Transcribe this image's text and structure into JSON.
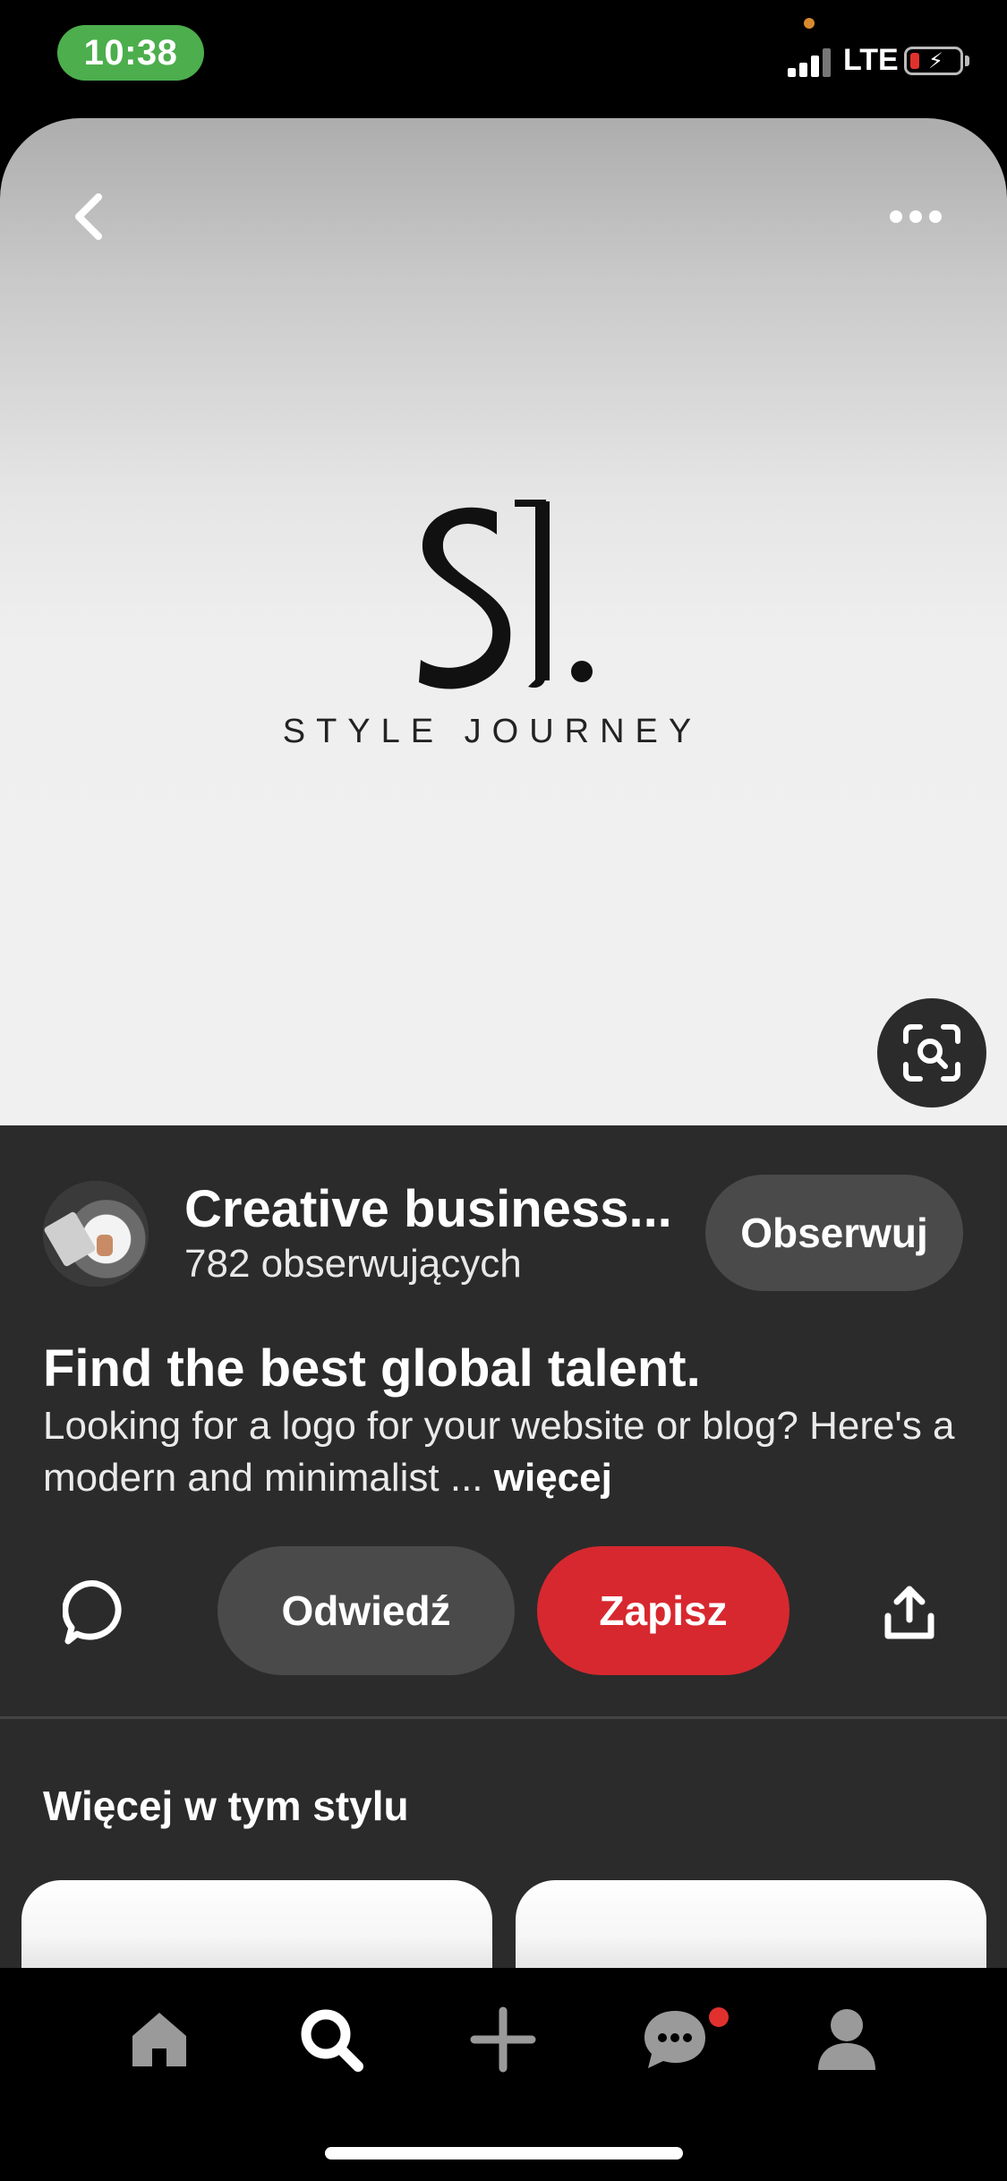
{
  "status_bar": {
    "time": "10:38",
    "network": "LTE",
    "battery_level": 0.1
  },
  "pin_image": {
    "logo_text": "STYLE JOURNEY",
    "logo_monogram": "SJ."
  },
  "board": {
    "name": "Creative business...",
    "followers": "782 obserwujących",
    "follow_label": "Obserwuj"
  },
  "pin": {
    "title": "Find the best global talent.",
    "description": "Looking for a logo for your website or blog? Here's a modern and minimalist ...",
    "more_label": "więcej"
  },
  "actions": {
    "visit_label": "Odwiedź",
    "save_label": "Zapisz"
  },
  "more_like_this": {
    "title": "Więcej w tym stylu"
  },
  "bottom_nav": {
    "items": [
      "home-icon",
      "search-icon",
      "create-icon",
      "messages-icon",
      "profile-icon"
    ],
    "active": "search-icon",
    "messages_badge": true
  },
  "colors": {
    "accent": "#d7282f",
    "panel": "#2b2b2b",
    "button_dark": "#4a4a4a",
    "time_pill": "#4cae4c"
  }
}
